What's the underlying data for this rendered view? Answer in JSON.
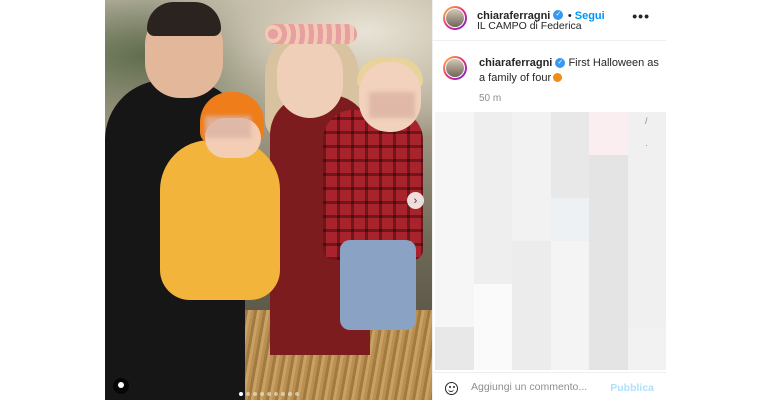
{
  "post": {
    "image_alt": "Family photo on hay bales",
    "carousel": {
      "total": 9,
      "current": 1
    }
  },
  "header": {
    "username": "chiaraferragni",
    "follow_label": "Segui",
    "location": "IL CAMPO di Federica",
    "more_label": "•••"
  },
  "caption": {
    "username": "chiaraferragni",
    "text": "First Halloween as a family of four",
    "time": "50 m"
  },
  "footer": {
    "comment_placeholder": "Aggiungi un commento...",
    "publish_label": "Pubblica"
  },
  "colors": {
    "accent": "#0095f6",
    "verified": "#3897f0",
    "publish_disabled": "#b2dffc"
  }
}
